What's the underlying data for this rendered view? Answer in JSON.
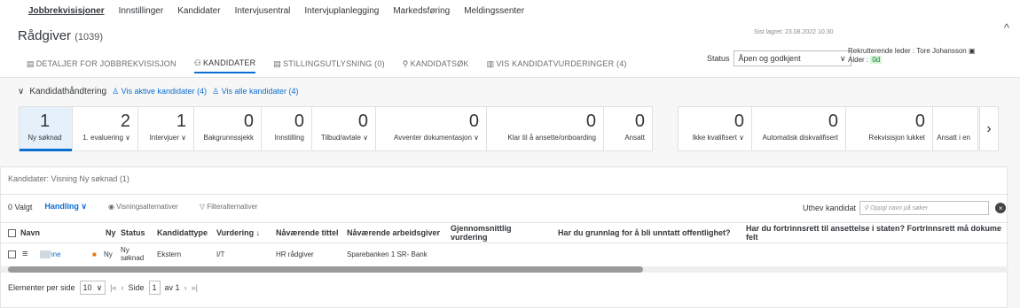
{
  "topnav": [
    "Jobbrekvisisjoner",
    "Innstillinger",
    "Kandidater",
    "Intervjusentral",
    "Intervjuplanlegging",
    "Markedsføring",
    "Meldingssenter"
  ],
  "header": {
    "title": "Rådgiver",
    "count": "(1039)",
    "saved": "Sist lagret: 23.08.2022 10.30",
    "collapse": "^",
    "tabs": [
      "DETALJER FOR JOBBREKVISISJON",
      "KANDIDATER",
      "STILLINGSUTLYSNING (0)",
      "KANDIDATSØK",
      "VIS KANDIDATVURDERINGER (4)"
    ],
    "status_label": "Status",
    "status_value": "Åpen og godkjent",
    "recruiter_label": "Rekrutterende leder : Tore Johansson",
    "age_label": "Alder :",
    "age_value": "0d"
  },
  "handling": {
    "title": "Kandidathåndtering",
    "active_link": "Vis aktive kandidater (4)",
    "all_link": "Vis alle kandidater (4)"
  },
  "stages": [
    {
      "n": "1",
      "l": "Ny søknad"
    },
    {
      "n": "2",
      "l": "1. evaluering ∨"
    },
    {
      "n": "1",
      "l": "Intervjuer ∨"
    },
    {
      "n": "0",
      "l": "Bakgrunnssjekk"
    },
    {
      "n": "0",
      "l": "Innstilling"
    },
    {
      "n": "0",
      "l": "Tilbud/avtale ∨"
    },
    {
      "n": "0",
      "l": "Avventer dokumentasjon ∨"
    },
    {
      "n": "0",
      "l": "Klar til å ansette/onboarding"
    },
    {
      "n": "0",
      "l": "Ansatt"
    }
  ],
  "stages2": [
    {
      "n": "0",
      "l": "Ikke kvalifisert ∨"
    },
    {
      "n": "0",
      "l": "Automatisk diskvalifisert"
    },
    {
      "n": "0",
      "l": "Rekvisisjon lukket"
    },
    {
      "n": "",
      "l": "Ansatt i en"
    }
  ],
  "panel": {
    "title": "Kandidater: Visning Ny søknad (1)",
    "valgt": "0 Valgt",
    "handling": "Handling ∨",
    "view_opts": "Visningsalternativer",
    "filter_opts": "Filteralternativer",
    "uthev": "Uthev kandidat",
    "search_placeholder": "Oppgi navn på søker"
  },
  "columns": [
    "Navn",
    "Ny",
    "Status",
    "Kandidattype",
    "Vurdering ↓",
    "Nåværende tittel",
    "Nåværende arbeidsgiver",
    "Gjennomsnittlig vurdering",
    "Har du grunnlag for å bli unntatt offentlighet?",
    "Har du fortrinnsrett til ansettelse i staten? Fortrinnsrett må dokume felt"
  ],
  "row": {
    "name": "Hanne",
    "ny": "Ny",
    "status": "Ny søknad",
    "type": "Ekstern",
    "vurdering": "I/T",
    "tittel": "HR rådgiver",
    "arbeidsgiver": "Sparebanken 1 SR- Bank"
  },
  "pager": {
    "per_page": "Elementer per side",
    "per_value": "10",
    "side": "Side",
    "page": "1",
    "of": "av 1"
  }
}
